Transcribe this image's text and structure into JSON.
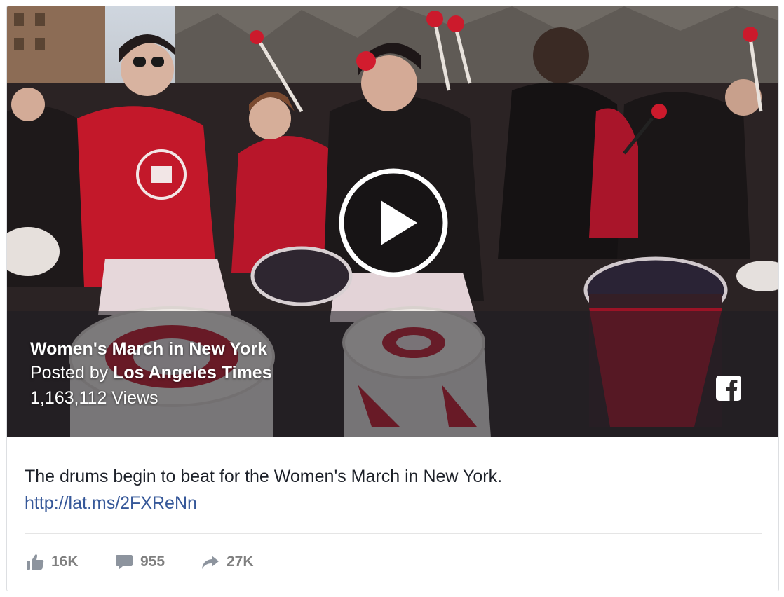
{
  "video": {
    "title": "Women's March in New York",
    "posted_prefix": "Posted by",
    "page_name": "Los Angeles Times",
    "views": "1,163,112 Views",
    "play_icon": "play-circle-icon",
    "brand_icon": "facebook-icon"
  },
  "post": {
    "caption": "The drums begin to beat for the Women's March in New York.",
    "link": "http://lat.ms/2FXReNn"
  },
  "stats": {
    "likes": "16K",
    "comments": "955",
    "shares": "27K"
  },
  "colors": {
    "link": "#365899",
    "text": "#1d2129",
    "muted": "#7f7f7f",
    "drum_red": "#c3182a"
  }
}
